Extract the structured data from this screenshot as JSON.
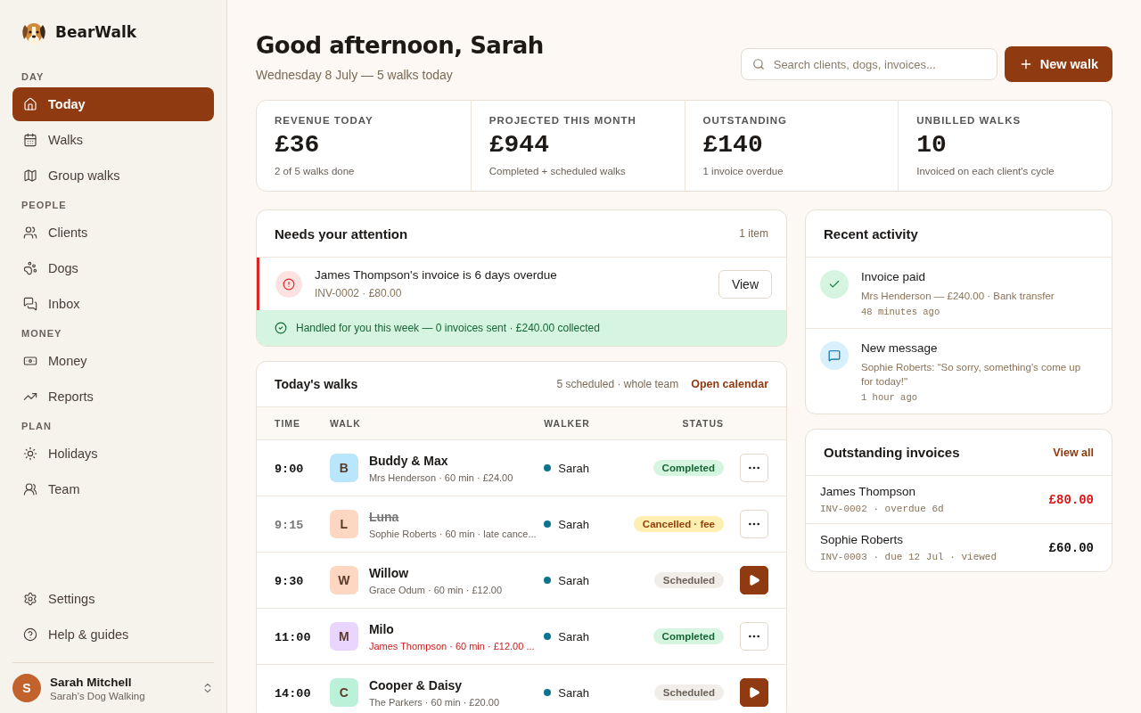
{
  "brand": {
    "name": "BearWalk"
  },
  "sidebar": {
    "sections": [
      {
        "title": "DAY",
        "items": [
          {
            "label": "Today",
            "selected": true
          },
          {
            "label": "Walks",
            "selected": false
          },
          {
            "label": "Group walks",
            "selected": false
          }
        ]
      },
      {
        "title": "PEOPLE",
        "items": [
          {
            "label": "Clients",
            "selected": false
          },
          {
            "label": "Dogs",
            "selected": false
          },
          {
            "label": "Inbox",
            "selected": false
          }
        ]
      },
      {
        "title": "MONEY",
        "items": [
          {
            "label": "Money",
            "selected": false
          },
          {
            "label": "Reports",
            "selected": false
          }
        ]
      },
      {
        "title": "PLAN",
        "items": [
          {
            "label": "Holidays",
            "selected": false
          },
          {
            "label": "Team",
            "selected": false
          }
        ]
      }
    ],
    "footer_items": [
      {
        "label": "Settings",
        "selected": false
      },
      {
        "label": "Help & guides",
        "selected": false
      }
    ],
    "user": {
      "initial": "S",
      "name": "Sarah Mitchell",
      "business": "Sarah's Dog Walking"
    }
  },
  "header": {
    "title": "Good afternoon, Sarah",
    "subtitle": "Wednesday 8 July — 5 walks today",
    "search": {
      "placeholder": "Search clients, dogs, invoices..."
    },
    "new_button": "New walk"
  },
  "stats": [
    {
      "label": "REVENUE TODAY",
      "value": "£36",
      "note": "2 of 5 walks done"
    },
    {
      "label": "PROJECTED THIS MONTH",
      "value": "£944",
      "note": "Completed + scheduled walks"
    },
    {
      "label": "OUTSTANDING",
      "value": "£140",
      "note": "1 invoice overdue"
    },
    {
      "label": "UNBILLED WALKS",
      "value": "10",
      "note": "Invoiced on each client's cycle"
    }
  ],
  "attention": {
    "title": "Needs your attention",
    "count": "1 item",
    "alerts": [
      {
        "title": "James Thompson's invoice is 6 days overdue",
        "detail": "INV-0002 · £80.00",
        "action": "View"
      }
    ],
    "summary": "Handled for you this week — 0 invoices sent · £240.00 collected"
  },
  "walks": {
    "title": "Today's walks",
    "meta": "5 scheduled · whole team",
    "link": "Open calendar",
    "columns": [
      "TIME",
      "WALK",
      "WALKER",
      "STATUS"
    ],
    "rows": [
      {
        "time": "9:00",
        "initial": "B",
        "color": "#bae6fd",
        "dog": "Buddy & Max",
        "detail": "Mrs Henderson · 60 min · £24.00",
        "flagged": false,
        "cancelled": false,
        "walker": "Sarah",
        "status": {
          "kind": "completed",
          "label": "Completed"
        },
        "action": {
          "kind": "menu"
        }
      },
      {
        "time": "9:15",
        "initial": "L",
        "color": "#fed7c3",
        "dog": "Luna",
        "detail": "Sophie Roberts · 60 min · late cance...",
        "flagged": false,
        "cancelled": true,
        "walker": "Sarah",
        "status": {
          "kind": "cancelled",
          "label": "Cancelled · fee"
        },
        "action": {
          "kind": "menu"
        }
      },
      {
        "time": "9:30",
        "initial": "W",
        "color": "#fed7c3",
        "dog": "Willow",
        "detail": "Grace Odum · 60 min · £12.00",
        "flagged": false,
        "cancelled": false,
        "walker": "Sarah",
        "status": {
          "kind": "scheduled",
          "label": "Scheduled"
        },
        "action": {
          "kind": "start"
        }
      },
      {
        "time": "11:00",
        "initial": "M",
        "color": "#e9d5ff",
        "dog": "Milo",
        "detail": "James Thompson · 60 min · £12.00 ...",
        "flagged": true,
        "cancelled": false,
        "walker": "Sarah",
        "status": {
          "kind": "completed",
          "label": "Completed"
        },
        "action": {
          "kind": "menu"
        }
      },
      {
        "time": "14:00",
        "initial": "C",
        "color": "#bbf0d9",
        "dog": "Cooper & Daisy",
        "detail": "The Parkers · 60 min · £20.00",
        "flagged": false,
        "cancelled": false,
        "walker": "Sarah",
        "status": {
          "kind": "scheduled",
          "label": "Scheduled"
        },
        "action": {
          "kind": "start"
        }
      }
    ]
  },
  "activity": {
    "title": "Recent activity",
    "items": [
      {
        "kind": "payment",
        "title": "Invoice paid",
        "detail": "Mrs Henderson — £240.00 · Bank transfer",
        "time": "48 minutes ago"
      },
      {
        "kind": "message",
        "title": "New message",
        "detail": "Sophie Roberts: “So sorry, something's come up for today!\"",
        "time": "1 hour ago"
      }
    ]
  },
  "invoices": {
    "title": "Outstanding invoices",
    "link": "View all",
    "items": [
      {
        "client": "James Thompson",
        "detail": "INV-0002 · overdue 6d",
        "amount": "£80.00",
        "overdue": true
      },
      {
        "client": "Sophie Roberts",
        "detail": "INV-0003 · due 12 Jul · viewed",
        "amount": "£60.00",
        "overdue": false
      }
    ]
  }
}
